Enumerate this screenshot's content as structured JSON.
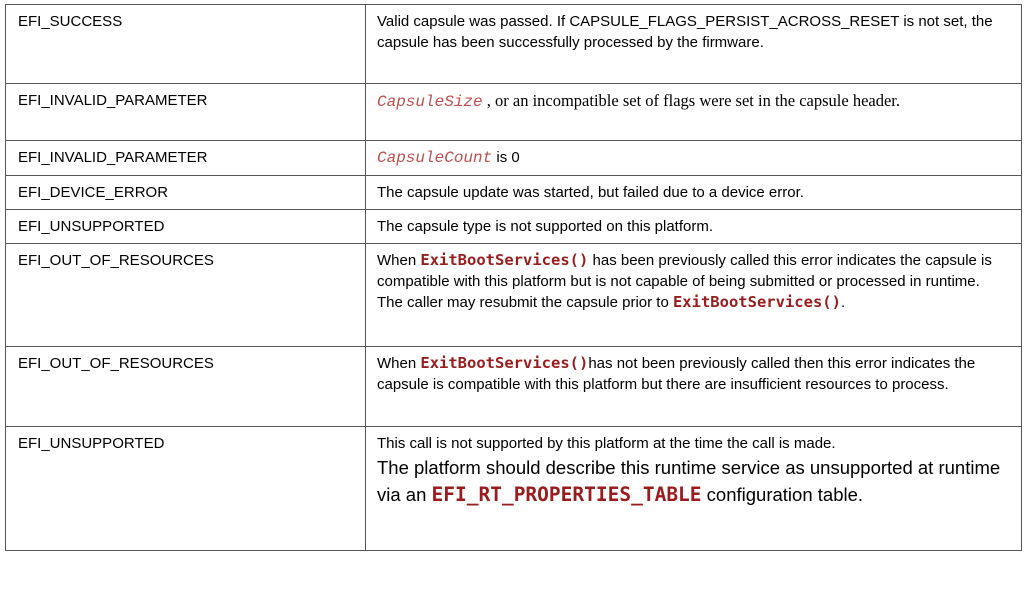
{
  "rows": [
    {
      "code": "EFI_SUCCESS",
      "desc": "Valid capsule was passed. If CAPSULE_FLAGS_PERSIST_ACROSS_RESET is not set, the capsule has been successfully processed by the firmware."
    },
    {
      "code": "EFI_INVALID_PARAMETER",
      "param": "CapsuleSize",
      "desc_after": " , or an incompatible set of flags were set in the capsule header."
    },
    {
      "code": "EFI_INVALID_PARAMETER",
      "param": "CapsuleCount",
      "desc_after": " is 0"
    },
    {
      "code": "EFI_DEVICE_ERROR",
      "desc": "The capsule update was started, but failed due to a device error."
    },
    {
      "code": "EFI_UNSUPPORTED",
      "desc": "The capsule type is not supported on this platform."
    },
    {
      "code": "EFI_OUT_OF_RESOURCES",
      "desc_before": "When ",
      "fn1": "ExitBootServices()",
      "desc_mid": "  has been previously called this error indicates the capsule is compatible with this platform but is not capable of being submitted or processed in runtime. The caller may resubmit the capsule prior to ",
      "fn2": "ExitBootServices()",
      "desc_end": "."
    },
    {
      "code": "EFI_OUT_OF_RESOURCES",
      "desc_before": "When ",
      "fn1": "ExitBootServices()",
      "desc_mid": "has not been previously called then this error indicates the capsule is compatible with this platform but there are insufficient resources to process."
    },
    {
      "code": "EFI_UNSUPPORTED",
      "desc": "This call is not supported by this platform at the time the call is made.",
      "desc_big": "The platform should describe this runtime service as unsupported at runtime via an ",
      "fn": "EFI_RT_PROPERTIES_TABLE",
      "desc_big_end": " configuration table."
    }
  ],
  "colors": {
    "param": "#c0504d",
    "function": "#9b1c1c",
    "border": "#555555"
  }
}
